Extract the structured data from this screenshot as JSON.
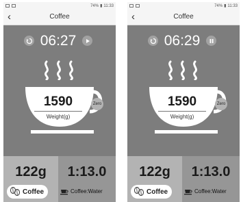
{
  "screens": [
    {
      "status_time": "11:33",
      "battery_text": "74%",
      "title": "Coffee",
      "timer": "06:27",
      "timer_state": "paused",
      "weight_value": "1590",
      "weight_label": "Weight(g)",
      "zero_label": "Zero",
      "coffee_weight": "122g",
      "ratio": "1:13.0",
      "mode_label": "Coffee",
      "ratio_label": "Coffee:Water"
    },
    {
      "status_time": "11:33",
      "battery_text": "74%",
      "title": "Coffee",
      "timer": "06:29",
      "timer_state": "running",
      "weight_value": "1590",
      "weight_label": "Weight(g)",
      "zero_label": "Zero",
      "coffee_weight": "122g",
      "ratio": "1:13.0",
      "mode_label": "Coffee",
      "ratio_label": "Coffee:Water"
    }
  ],
  "colors": {
    "screen_bg": "#7d7d7d",
    "panel_left": "#b3b3b3",
    "panel_right": "#969696",
    "button_bg": "#a2a2a2"
  },
  "icons": {
    "back": "back-arrow-icon",
    "reset": "reset-icon",
    "play": "play-icon",
    "pause": "pause-icon",
    "steam": "steam-icon",
    "cup": "cup-icon",
    "beans": "coffee-beans-icon",
    "ratio": "cup-saucer-icon"
  }
}
